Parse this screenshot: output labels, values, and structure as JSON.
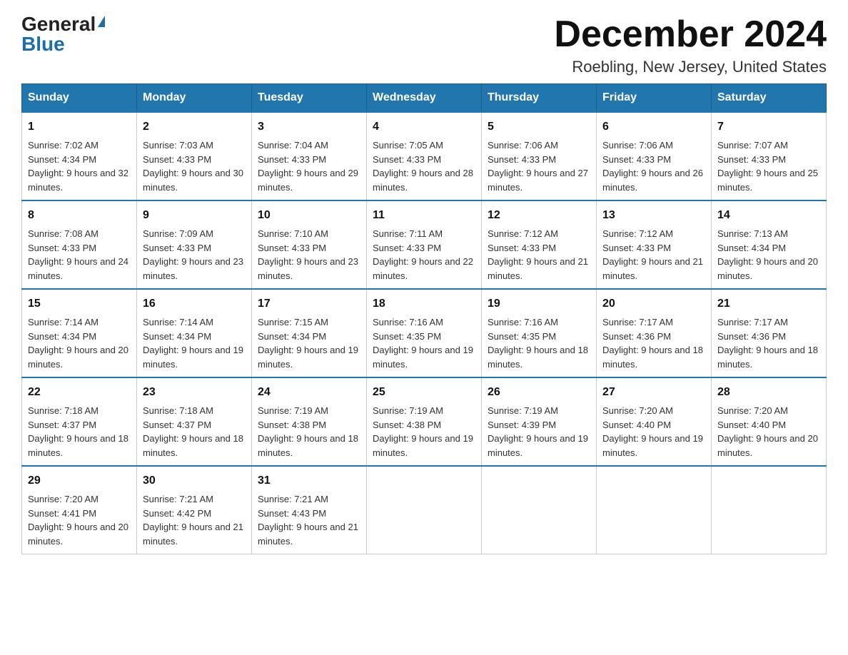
{
  "logo": {
    "general": "General",
    "blue": "Blue"
  },
  "title": {
    "month": "December 2024",
    "location": "Roebling, New Jersey, United States"
  },
  "days_of_week": [
    "Sunday",
    "Monday",
    "Tuesday",
    "Wednesday",
    "Thursday",
    "Friday",
    "Saturday"
  ],
  "weeks": [
    [
      {
        "day": "1",
        "sunrise": "7:02 AM",
        "sunset": "4:34 PM",
        "daylight": "9 hours and 32 minutes."
      },
      {
        "day": "2",
        "sunrise": "7:03 AM",
        "sunset": "4:33 PM",
        "daylight": "9 hours and 30 minutes."
      },
      {
        "day": "3",
        "sunrise": "7:04 AM",
        "sunset": "4:33 PM",
        "daylight": "9 hours and 29 minutes."
      },
      {
        "day": "4",
        "sunrise": "7:05 AM",
        "sunset": "4:33 PM",
        "daylight": "9 hours and 28 minutes."
      },
      {
        "day": "5",
        "sunrise": "7:06 AM",
        "sunset": "4:33 PM",
        "daylight": "9 hours and 27 minutes."
      },
      {
        "day": "6",
        "sunrise": "7:06 AM",
        "sunset": "4:33 PM",
        "daylight": "9 hours and 26 minutes."
      },
      {
        "day": "7",
        "sunrise": "7:07 AM",
        "sunset": "4:33 PM",
        "daylight": "9 hours and 25 minutes."
      }
    ],
    [
      {
        "day": "8",
        "sunrise": "7:08 AM",
        "sunset": "4:33 PM",
        "daylight": "9 hours and 24 minutes."
      },
      {
        "day": "9",
        "sunrise": "7:09 AM",
        "sunset": "4:33 PM",
        "daylight": "9 hours and 23 minutes."
      },
      {
        "day": "10",
        "sunrise": "7:10 AM",
        "sunset": "4:33 PM",
        "daylight": "9 hours and 23 minutes."
      },
      {
        "day": "11",
        "sunrise": "7:11 AM",
        "sunset": "4:33 PM",
        "daylight": "9 hours and 22 minutes."
      },
      {
        "day": "12",
        "sunrise": "7:12 AM",
        "sunset": "4:33 PM",
        "daylight": "9 hours and 21 minutes."
      },
      {
        "day": "13",
        "sunrise": "7:12 AM",
        "sunset": "4:33 PM",
        "daylight": "9 hours and 21 minutes."
      },
      {
        "day": "14",
        "sunrise": "7:13 AM",
        "sunset": "4:34 PM",
        "daylight": "9 hours and 20 minutes."
      }
    ],
    [
      {
        "day": "15",
        "sunrise": "7:14 AM",
        "sunset": "4:34 PM",
        "daylight": "9 hours and 20 minutes."
      },
      {
        "day": "16",
        "sunrise": "7:14 AM",
        "sunset": "4:34 PM",
        "daylight": "9 hours and 19 minutes."
      },
      {
        "day": "17",
        "sunrise": "7:15 AM",
        "sunset": "4:34 PM",
        "daylight": "9 hours and 19 minutes."
      },
      {
        "day": "18",
        "sunrise": "7:16 AM",
        "sunset": "4:35 PM",
        "daylight": "9 hours and 19 minutes."
      },
      {
        "day": "19",
        "sunrise": "7:16 AM",
        "sunset": "4:35 PM",
        "daylight": "9 hours and 18 minutes."
      },
      {
        "day": "20",
        "sunrise": "7:17 AM",
        "sunset": "4:36 PM",
        "daylight": "9 hours and 18 minutes."
      },
      {
        "day": "21",
        "sunrise": "7:17 AM",
        "sunset": "4:36 PM",
        "daylight": "9 hours and 18 minutes."
      }
    ],
    [
      {
        "day": "22",
        "sunrise": "7:18 AM",
        "sunset": "4:37 PM",
        "daylight": "9 hours and 18 minutes."
      },
      {
        "day": "23",
        "sunrise": "7:18 AM",
        "sunset": "4:37 PM",
        "daylight": "9 hours and 18 minutes."
      },
      {
        "day": "24",
        "sunrise": "7:19 AM",
        "sunset": "4:38 PM",
        "daylight": "9 hours and 18 minutes."
      },
      {
        "day": "25",
        "sunrise": "7:19 AM",
        "sunset": "4:38 PM",
        "daylight": "9 hours and 19 minutes."
      },
      {
        "day": "26",
        "sunrise": "7:19 AM",
        "sunset": "4:39 PM",
        "daylight": "9 hours and 19 minutes."
      },
      {
        "day": "27",
        "sunrise": "7:20 AM",
        "sunset": "4:40 PM",
        "daylight": "9 hours and 19 minutes."
      },
      {
        "day": "28",
        "sunrise": "7:20 AM",
        "sunset": "4:40 PM",
        "daylight": "9 hours and 20 minutes."
      }
    ],
    [
      {
        "day": "29",
        "sunrise": "7:20 AM",
        "sunset": "4:41 PM",
        "daylight": "9 hours and 20 minutes."
      },
      {
        "day": "30",
        "sunrise": "7:21 AM",
        "sunset": "4:42 PM",
        "daylight": "9 hours and 21 minutes."
      },
      {
        "day": "31",
        "sunrise": "7:21 AM",
        "sunset": "4:43 PM",
        "daylight": "9 hours and 21 minutes."
      },
      null,
      null,
      null,
      null
    ]
  ]
}
